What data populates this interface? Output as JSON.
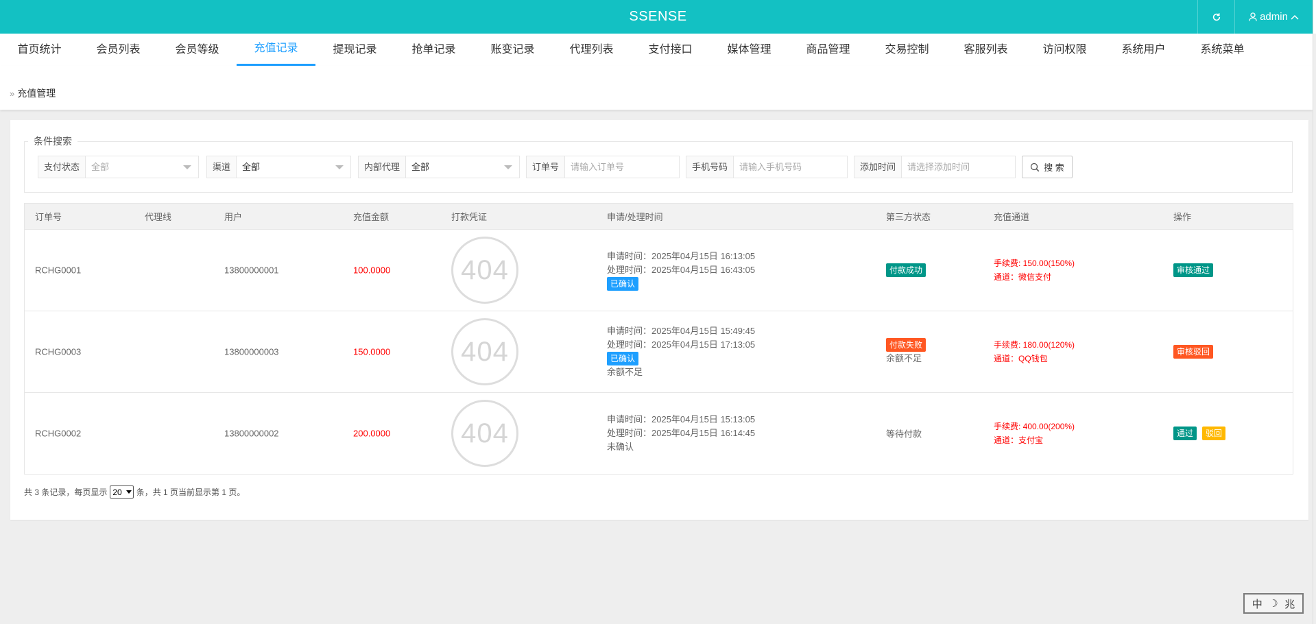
{
  "app": {
    "title": "SSENSE"
  },
  "header": {
    "user_label": "admin"
  },
  "nav": {
    "tabs": [
      {
        "label": "首页统计"
      },
      {
        "label": "会员列表"
      },
      {
        "label": "会员等级"
      },
      {
        "label": "充值记录"
      },
      {
        "label": "提现记录"
      },
      {
        "label": "抢单记录"
      },
      {
        "label": "账变记录"
      },
      {
        "label": "代理列表"
      },
      {
        "label": "支付接口"
      },
      {
        "label": "媒体管理"
      },
      {
        "label": "商品管理"
      },
      {
        "label": "交易控制"
      },
      {
        "label": "客服列表"
      },
      {
        "label": "访问权限"
      },
      {
        "label": "系统用户"
      },
      {
        "label": "系统菜单"
      }
    ],
    "active_index": 3
  },
  "breadcrumb": {
    "separator": "»",
    "current": "充值管理"
  },
  "search": {
    "legend": "条件搜索",
    "pay_status": {
      "label": "支付状态",
      "value": "全部"
    },
    "channel": {
      "label": "渠道",
      "value": "全部"
    },
    "internal_agent": {
      "label": "内部代理",
      "value": "全部"
    },
    "order_no": {
      "label": "订单号",
      "placeholder": "请输入订单号"
    },
    "phone": {
      "label": "手机号码",
      "placeholder": "请输入手机号码"
    },
    "add_time": {
      "label": "添加时间",
      "placeholder": "请选择添加时间"
    },
    "button_label": "搜 索"
  },
  "table": {
    "headers": {
      "order_no": "订单号",
      "agent_line": "代理线",
      "user": "用户",
      "amount": "充值金额",
      "voucher": "打款凭证",
      "time": "申请/处理时间",
      "third_status": "第三方状态",
      "channel": "充值通道",
      "ops": "操作"
    },
    "rows": [
      {
        "order_no": "RCHG0001",
        "agent_line": "",
        "user": "13800000001",
        "amount": "100.0000",
        "voucher": "404",
        "apply_time": "申请时间：2025年04月15日 16:13:05",
        "process_time": "处理时间：2025年04月15日 16:43:05",
        "confirm_badge": "已确认",
        "third_status_badge": "付款成功",
        "third_status_color": "#009688",
        "fee": "手续费: 150.00(150%)",
        "channel": "通道：微信支付",
        "op1": "审核通过",
        "op1_color": "#009688"
      },
      {
        "order_no": "RCHG0003",
        "agent_line": "",
        "user": "13800000003",
        "amount": "150.0000",
        "voucher": "404",
        "apply_time": "申请时间：2025年04月15日 15:49:45",
        "process_time": "处理时间：2025年04月15日 17:13:05",
        "confirm_badge": "已确认",
        "remark": "余额不足",
        "third_status_badge": "付款失败",
        "third_status_color": "#ff5722",
        "third_status_note": "余额不足",
        "fee": "手续费: 180.00(120%)",
        "channel": "通道：QQ钱包",
        "op1": "审核驳回",
        "op1_color": "#ff5722"
      },
      {
        "order_no": "RCHG0002",
        "agent_line": "",
        "user": "13800000002",
        "amount": "200.0000",
        "voucher": "404",
        "apply_time": "申请时间：2025年04月15日 15:13:05",
        "process_time": "处理时间：2025年04月15日 16:14:45",
        "confirm_text": "未确认",
        "third_status_text": "等待付款",
        "fee": "手续费: 400.00(200%)",
        "channel": "通道：支付宝",
        "op1": "通过",
        "op1_color": "#009688",
        "op2": "驳回",
        "op2_color": "#ffb800"
      }
    ]
  },
  "pagination": {
    "prefix": "共 3 条记录，每页显示",
    "per_page": "20",
    "suffix": "条，共 1 页当前显示第 1 页。"
  },
  "ime": {
    "lang": "中",
    "moon": "☽",
    "mode": "兆"
  }
}
